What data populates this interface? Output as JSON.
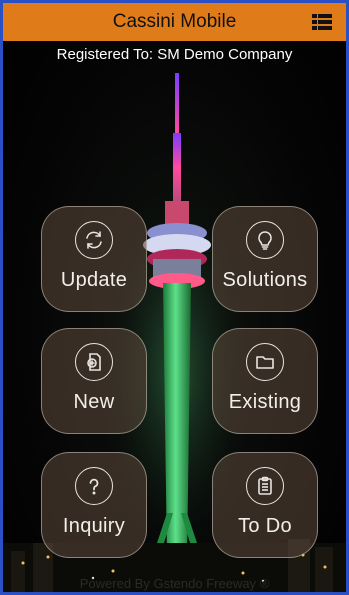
{
  "app": {
    "title": "Cassini Mobile",
    "menu_icon": "list-menu-icon",
    "accent_color": "#e07b1a"
  },
  "registration": {
    "text": "Registered To: SM Demo Company"
  },
  "tiles": [
    {
      "label": "Update",
      "icon": "refresh-icon"
    },
    {
      "label": "Solutions",
      "icon": "lightbulb-icon"
    },
    {
      "label": "New",
      "icon": "new-document-icon"
    },
    {
      "label": "Existing",
      "icon": "folder-icon"
    },
    {
      "label": "Inquiry",
      "icon": "question-icon"
    },
    {
      "label": "To Do",
      "icon": "clipboard-icon"
    }
  ],
  "footer": {
    "text": "Powered By Gstendo Freeway ®"
  }
}
